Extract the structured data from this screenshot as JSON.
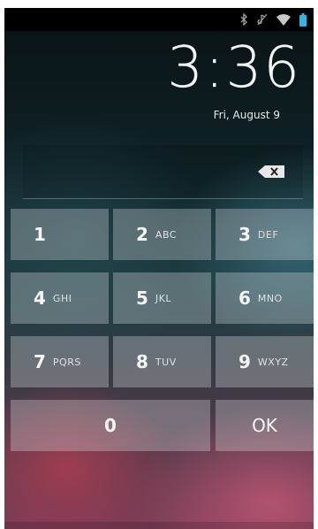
{
  "status_bar": {
    "icons": [
      "bluetooth-icon",
      "silent-mode-icon",
      "wifi-icon",
      "battery-icon"
    ]
  },
  "lock_screen": {
    "time": "3:36",
    "date": "Fri, August 9"
  },
  "pin_entry": {
    "value": "",
    "backspace_icon": "backspace-icon"
  },
  "keypad": {
    "keys": [
      {
        "num": "1",
        "letters": ""
      },
      {
        "num": "2",
        "letters": "ABC"
      },
      {
        "num": "3",
        "letters": "DEF"
      },
      {
        "num": "4",
        "letters": "GHI"
      },
      {
        "num": "5",
        "letters": "JKL"
      },
      {
        "num": "6",
        "letters": "MNO"
      },
      {
        "num": "7",
        "letters": "PQRS"
      },
      {
        "num": "8",
        "letters": "TUV"
      },
      {
        "num": "9",
        "letters": "WXYZ"
      },
      {
        "num": "0",
        "letters": ""
      },
      {
        "num": "OK",
        "letters": ""
      }
    ]
  },
  "colors": {
    "status_bar_bg": "#000000",
    "battery": "#33b5e5",
    "key_bg": "rgba(220,225,228,0.32)"
  }
}
